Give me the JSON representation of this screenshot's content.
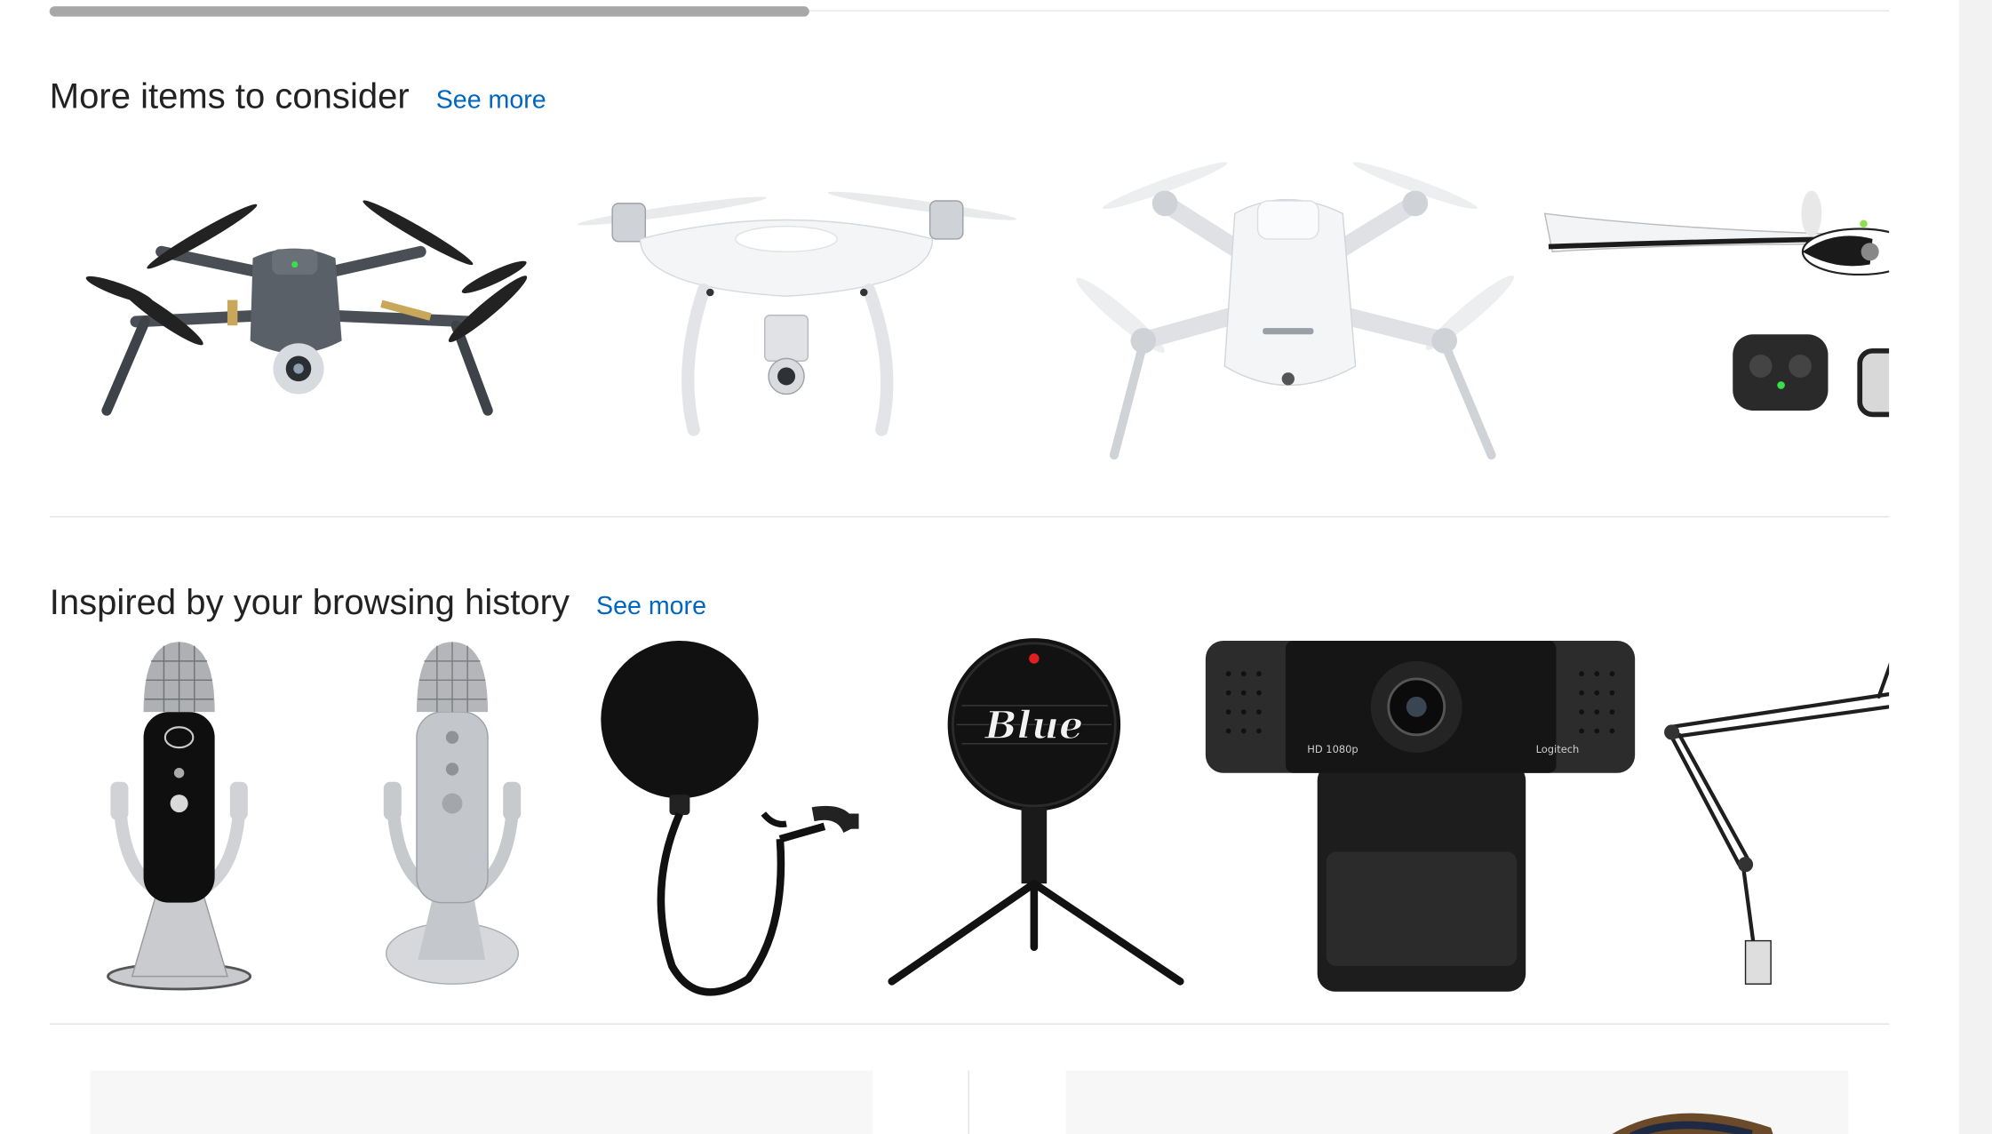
{
  "shelves": [
    {
      "title": "More items to consider",
      "see_more": "See more",
      "items": [
        {
          "icon": "drone-dark-foldable-icon"
        },
        {
          "icon": "drone-white-quad-camera-icon"
        },
        {
          "icon": "drone-white-compact-icon"
        },
        {
          "icon": "drone-fixed-wing-icon"
        }
      ]
    },
    {
      "title": "Inspired by your browsing history",
      "see_more": "See more",
      "items": [
        {
          "icon": "usb-microphone-black-icon"
        },
        {
          "icon": "usb-microphone-silver-icon"
        },
        {
          "icon": "pop-filter-icon"
        },
        {
          "icon": "tripod-microphone-icon",
          "label": "Blue"
        },
        {
          "icon": "webcam-icon",
          "label": "Logitech",
          "sublabel": "HD 1080p"
        },
        {
          "icon": "boom-arm-icon"
        }
      ]
    }
  ],
  "colors": {
    "link": "#0066c0",
    "title": "#222222",
    "divider": "#e3e3e3"
  }
}
